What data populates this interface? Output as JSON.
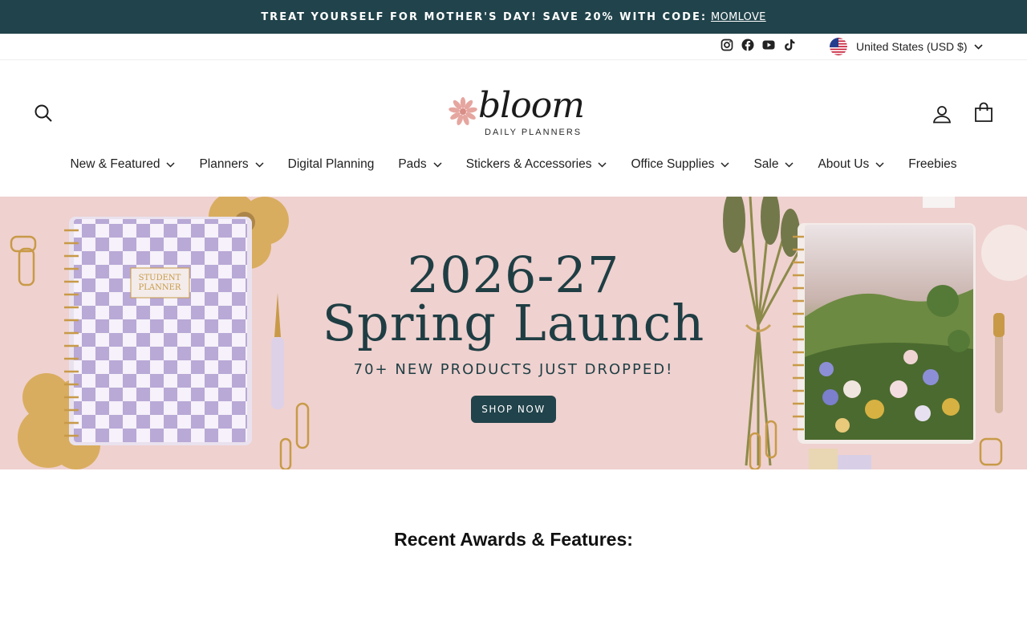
{
  "announcement": {
    "text": "TREAT YOURSELF FOR MOTHER'S DAY! SAVE 20% WITH CODE:",
    "code": "MOMLOVE"
  },
  "utility": {
    "socials": [
      "instagram-icon",
      "facebook-icon",
      "youtube-icon",
      "tiktok-icon"
    ],
    "currency": "United States (USD $)"
  },
  "header": {
    "logo_word": "bloom",
    "logo_sub": "DAILY PLANNERS",
    "icons": [
      "search-icon",
      "account-icon",
      "cart-icon"
    ]
  },
  "nav": {
    "items": [
      {
        "label": "New & Featured",
        "dropdown": true
      },
      {
        "label": "Planners",
        "dropdown": true
      },
      {
        "label": "Digital Planning",
        "dropdown": false
      },
      {
        "label": "Pads",
        "dropdown": true
      },
      {
        "label": "Stickers & Accessories",
        "dropdown": true
      },
      {
        "label": "Office Supplies",
        "dropdown": true
      },
      {
        "label": "Sale",
        "dropdown": true
      },
      {
        "label": "About Us",
        "dropdown": true
      },
      {
        "label": "Freebies",
        "dropdown": false
      }
    ]
  },
  "hero": {
    "year": "2026-27",
    "title": "Spring Launch",
    "subtitle": "70+ NEW PRODUCTS JUST DROPPED!",
    "cta": "SHOP NOW",
    "planner_cover_text": "STUDENT PLANNER"
  },
  "section": {
    "heading": "Recent Awards & Features:"
  },
  "colors": {
    "brand_dark": "#21434b",
    "hero_bg": "#efd1cf",
    "lavender": "#b9a9d6",
    "accent_pink": "#e6a6a0"
  }
}
